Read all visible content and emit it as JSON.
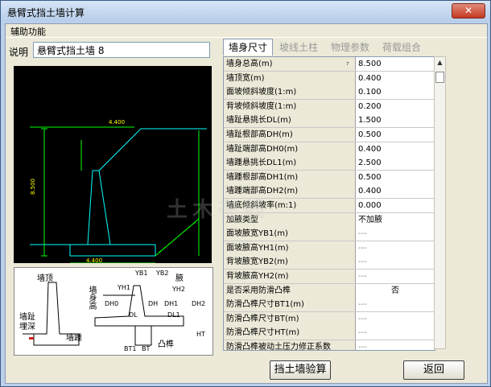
{
  "window": {
    "title": "悬臂式挡土墙计算",
    "close_glyph": "✕"
  },
  "menu": {
    "aux": "辅助功能"
  },
  "description": {
    "label": "说明",
    "value": "悬臂式挡土墙 8"
  },
  "tabs": [
    {
      "label": "墙身尺寸",
      "active": true
    },
    {
      "label": "坡线土柱",
      "active": false
    },
    {
      "label": "物理参数",
      "active": false
    },
    {
      "label": "荷载组合",
      "active": false
    }
  ],
  "params": [
    {
      "name": "墙身总高(m)",
      "value": "8.500"
    },
    {
      "name": "墙顶宽(m)",
      "value": "0.400"
    },
    {
      "name": "面坡倾斜坡度(1:m)",
      "value": "0.100"
    },
    {
      "name": "背坡倾斜坡度(1:m)",
      "value": "0.200"
    },
    {
      "name": "墙趾悬挑长DL(m)",
      "value": "1.500"
    },
    {
      "name": "墙趾根部高DH(m)",
      "value": "0.500"
    },
    {
      "name": "墙趾端部高DH0(m)",
      "value": "0.400"
    },
    {
      "name": "墙踵悬挑长DL1(m)",
      "value": "2.500"
    },
    {
      "name": "墙踵根部高DH1(m)",
      "value": "0.500"
    },
    {
      "name": "墙踵端部高DH2(m)",
      "value": "0.400"
    },
    {
      "name": "墙底倾斜坡率(m:1)",
      "value": "0.000"
    },
    {
      "name": "加腋类型",
      "value": "不加腋"
    },
    {
      "name": "面坡腋宽YB1(m)",
      "value": "---"
    },
    {
      "name": "面坡腋高YH1(m)",
      "value": "---"
    },
    {
      "name": "背坡腋宽YB2(m)",
      "value": "---"
    },
    {
      "name": "背坡腋高YH2(m)",
      "value": "---"
    },
    {
      "name": "是否采用防滑凸榫",
      "value": "否"
    },
    {
      "name": "防滑凸榫尺寸BT1(m)",
      "value": "---"
    },
    {
      "name": "防滑凸榫尺寸BT(m)",
      "value": "---"
    },
    {
      "name": "防滑凸榫尺寸HT(m)",
      "value": "---"
    },
    {
      "name": "防滑凸榫被动土压力修正系数",
      "value": "---"
    }
  ],
  "legend": {
    "wall_top": "墙顶",
    "wall_height": "墙身高",
    "toe": "墙趾",
    "toe_depth": "埋深",
    "heel": "墙踵",
    "haunch": "腋",
    "key": "凸榫",
    "labels": [
      "YB1",
      "YB2",
      "YH1",
      "YH2",
      "DH0",
      "DH",
      "DH1",
      "DH2",
      "DL",
      "DL1",
      "BT1",
      "BT",
      "HT"
    ]
  },
  "buttons": {
    "check": "挡土墙验算",
    "back": "返回"
  },
  "watermark": "土木在线",
  "colors": {
    "cad_bg": "#000000",
    "cad_line": "#00ffff",
    "cad_dim": "#00ff00",
    "cad_text": "#ffff00"
  }
}
